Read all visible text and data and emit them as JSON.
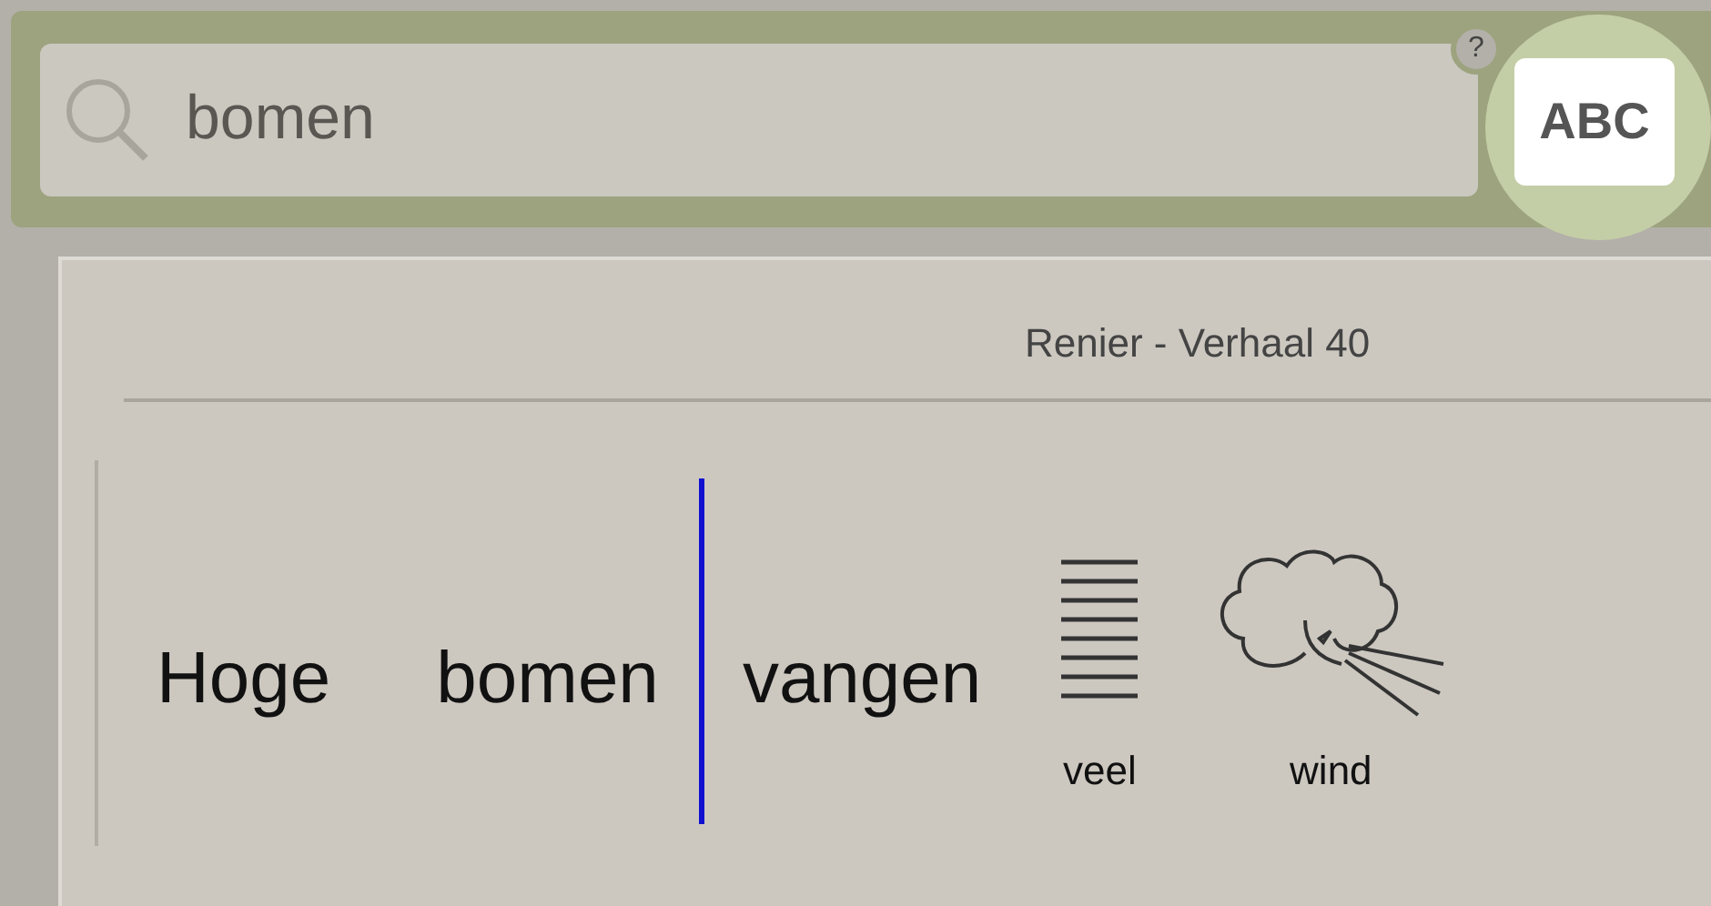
{
  "search": {
    "value": "bomen",
    "help": "?",
    "mode_button": {
      "label": "ABC",
      "highlighted": true
    }
  },
  "document": {
    "title": "Renier - Verhaal 40",
    "items": [
      {
        "kind": "word",
        "text": "Hoge"
      },
      {
        "kind": "word",
        "text": "bomen"
      },
      {
        "kind": "cursor"
      },
      {
        "kind": "word",
        "text": "vangen"
      },
      {
        "kind": "lines",
        "text": "veel"
      },
      {
        "kind": "wind",
        "text": "wind"
      }
    ]
  }
}
